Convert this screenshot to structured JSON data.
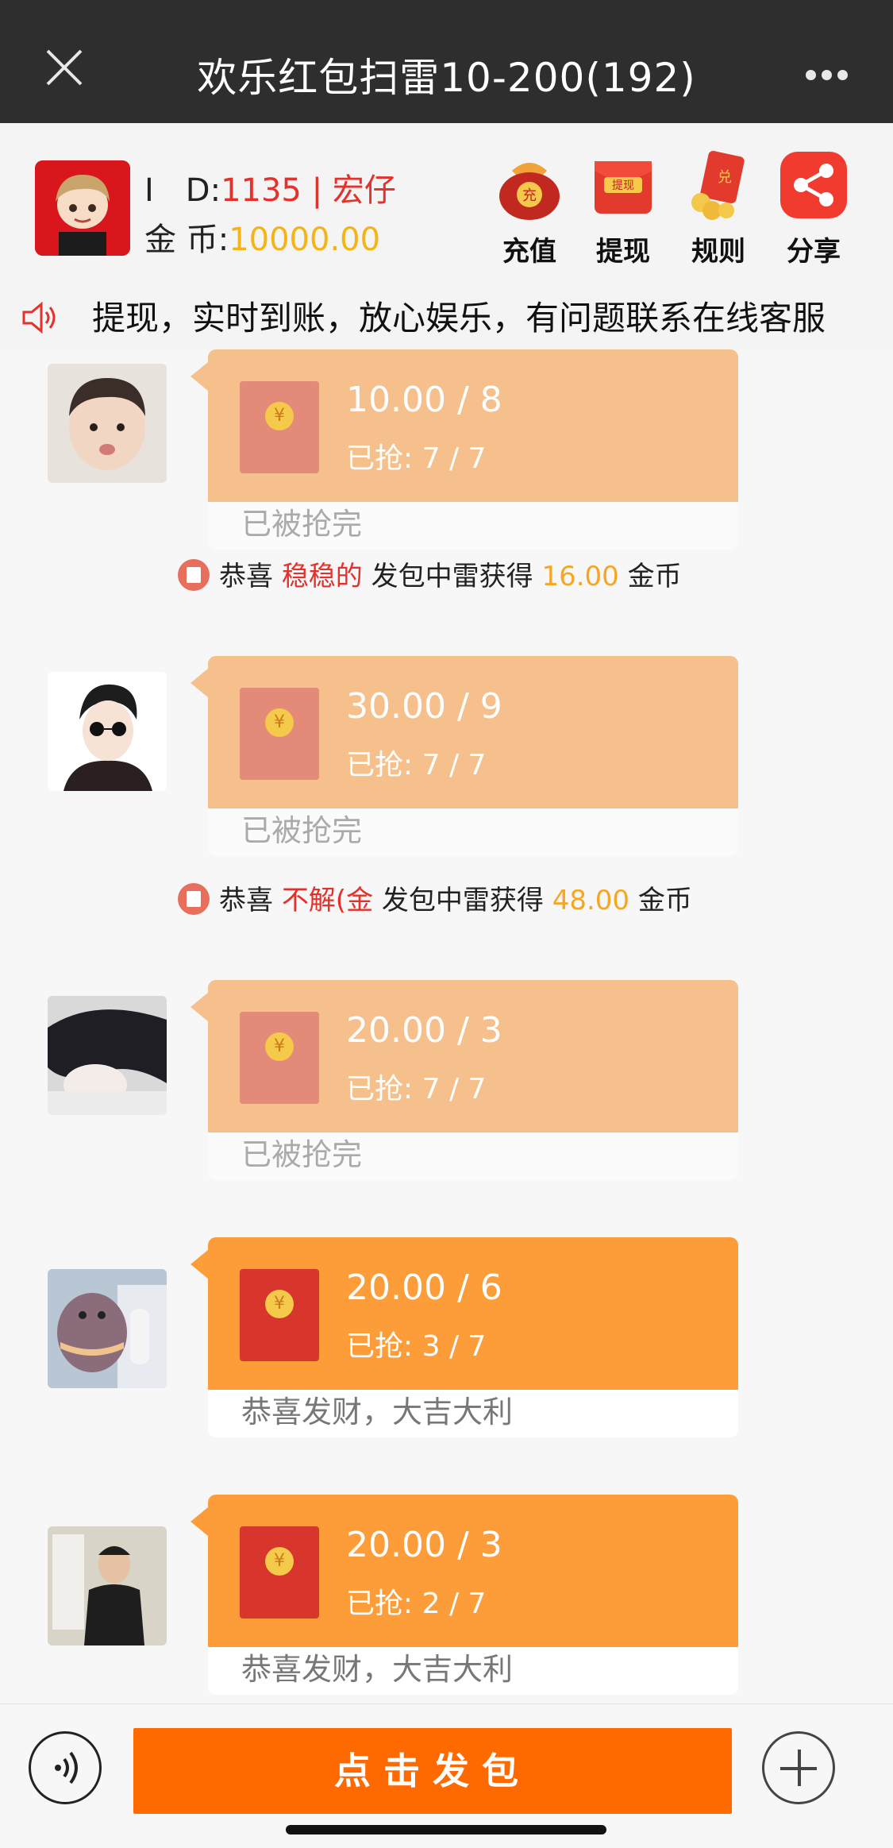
{
  "nav": {
    "title": "欢乐红包扫雷10-200(192)"
  },
  "user": {
    "id_label": "I　D:",
    "id_value": "1135 | 宏仔",
    "coin_label": "金 币:",
    "coin_value": "10000.00"
  },
  "actions": [
    {
      "label": "充值",
      "icon": "recharge-bag-icon"
    },
    {
      "label": "提现",
      "icon": "withdraw-envelope-icon"
    },
    {
      "label": "规则",
      "icon": "rules-envelope-icon"
    },
    {
      "label": "分享",
      "icon": "share-icon"
    }
  ],
  "marquee": {
    "text": "提现，实时到账，放心娱乐，有问题联系在线客服"
  },
  "messages": [
    {
      "amount": "10.00 / 8",
      "grab_label": "已抢:",
      "grab_count": "7 / 7",
      "footer": "已被抢完",
      "state": "grabbed"
    },
    {
      "amount": "30.00 / 9",
      "grab_label": "已抢:",
      "grab_count": "7 / 7",
      "footer": "已被抢完",
      "state": "grabbed"
    },
    {
      "amount": "20.00 / 3",
      "grab_label": "已抢:",
      "grab_count": "7 / 7",
      "footer": "已被抢完",
      "state": "grabbed"
    },
    {
      "amount": "20.00 / 6",
      "grab_label": "已抢:",
      "grab_count": "3 / 7",
      "footer": "恭喜发财，大吉大利",
      "state": "active"
    },
    {
      "amount": "20.00 / 3",
      "grab_label": "已抢:",
      "grab_count": "2 / 7",
      "footer": "恭喜发财，大吉大利",
      "state": "active"
    }
  ],
  "notices": [
    {
      "prefix": "恭喜",
      "name": "稳稳的",
      "middle": "发包中雷获得",
      "amount": "16.00",
      "suffix": "金币"
    },
    {
      "prefix": "恭喜",
      "name": "不解(金",
      "middle": "发包中雷获得",
      "amount": "48.00",
      "suffix": "金币"
    }
  ],
  "bottom": {
    "send_label": "点击发包"
  },
  "colors": {
    "accent": "#ff6a00",
    "grabbed_bubble": "#f6c08d",
    "active_bubble": "#fd9d3a",
    "name_red": "#e4312c",
    "coin_yellow": "#f5b316"
  }
}
